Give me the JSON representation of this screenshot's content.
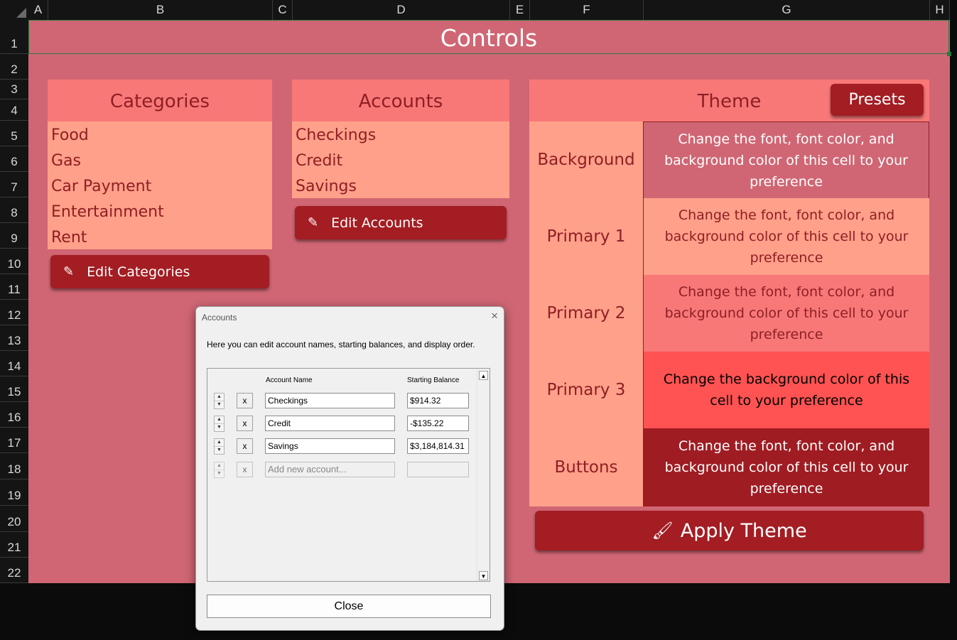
{
  "column_headers": [
    "A",
    "B",
    "C",
    "D",
    "E",
    "F",
    "G",
    "H"
  ],
  "row_headers": [
    "1",
    "2",
    "3",
    "4",
    "5",
    "6",
    "7",
    "8",
    "9",
    "10",
    "11",
    "12",
    "13",
    "14",
    "15",
    "16",
    "17",
    "18",
    "19",
    "20",
    "21",
    "22"
  ],
  "title": "Controls",
  "categories": {
    "heading": "Categories",
    "items": [
      "Food",
      "Gas",
      "Car Payment",
      "Entertainment",
      "Rent"
    ],
    "edit_button": "Edit Categories"
  },
  "accounts": {
    "heading": "Accounts",
    "items": [
      "Checkings",
      "Credit",
      "Savings"
    ],
    "edit_button": "Edit Accounts"
  },
  "theme": {
    "heading": "Theme",
    "presets_button": "Presets",
    "rows": [
      {
        "label": "Background",
        "text": "Change the font, font color, and background color of this cell to your preference",
        "bg": "#d06674",
        "fg": "#ffffff"
      },
      {
        "label": "Primary 1",
        "text": "Change the font, font color, and background color of this cell to your preference",
        "bg": "#ffa08a",
        "fg": "#8e1f24"
      },
      {
        "label": "Primary 2",
        "text": "Change the font, font color, and background color of this cell to your preference",
        "bg": "#f87878",
        "fg": "#8e1f24"
      },
      {
        "label": "Primary 3",
        "text": "Change the background color of this cell to your preference",
        "bg": "#ff5252",
        "fg": "#000000"
      },
      {
        "label": "Buttons",
        "text": "Change the font, font color, and background color of this cell to your preference",
        "bg": "#9f1c22",
        "fg": "#ffffff"
      }
    ],
    "apply_button": "Apply Theme"
  },
  "dialog": {
    "title": "Accounts",
    "description": "Here you can edit account names, starting balances, and display order.",
    "col_name": "Account Name",
    "col_balance": "Starting Balance",
    "rows": [
      {
        "name": "Checkings",
        "balance": "$914.32"
      },
      {
        "name": "Credit",
        "balance": "-$135.22"
      },
      {
        "name": "Savings",
        "balance": "$3,184,814.31"
      }
    ],
    "new_placeholder": "Add new account...",
    "delete_label": "x",
    "close_button": "Close",
    "close_icon": "×"
  },
  "colors": {
    "sheet_bg": "#d06674",
    "primary1": "#ffa08a",
    "primary2": "#f87878",
    "primary3": "#ff5252",
    "button": "#a31d23",
    "text_dark": "#8e1f24"
  }
}
